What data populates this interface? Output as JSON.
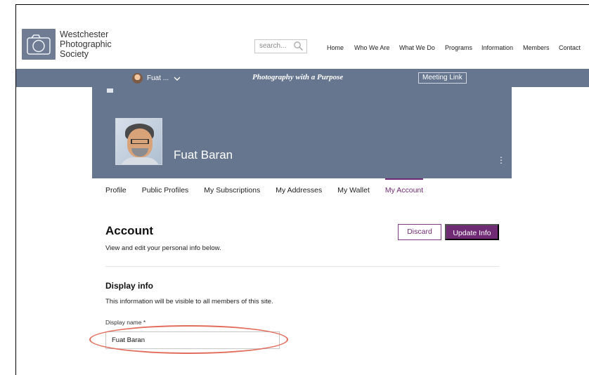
{
  "brand": {
    "lines": [
      "Westchester",
      "Photographic",
      "Society"
    ],
    "logo_icon": "camera-icon",
    "logo_color": "#6f7c93"
  },
  "search": {
    "placeholder": "search...",
    "icon": "search-icon"
  },
  "nav": {
    "items": [
      "Home",
      "Who We Are",
      "What We Do",
      "Programs",
      "Information",
      "Members",
      "Contact"
    ]
  },
  "band": {
    "member_name": "Fuat ...",
    "tagline": "Photography with a Purpose",
    "meeting_link": "Meeting Link",
    "color": "#66768f"
  },
  "profile": {
    "name": "Fuat Baran"
  },
  "tabs": [
    "Profile",
    "Public Profiles",
    "My Subscriptions",
    "My Addresses",
    "My Wallet",
    "My Account"
  ],
  "account": {
    "title": "Account",
    "subtitle": "View and edit your personal info below.",
    "discard_label": "Discard",
    "update_label": "Update Info",
    "accent_color": "#6f2b74"
  },
  "display_info": {
    "title": "Display info",
    "subtitle": "This information will be visible to all members of this site.",
    "field_label": "Display name *",
    "field_value": "Fuat Baran"
  },
  "annotation": {
    "highlight_color": "#e26d5c"
  }
}
